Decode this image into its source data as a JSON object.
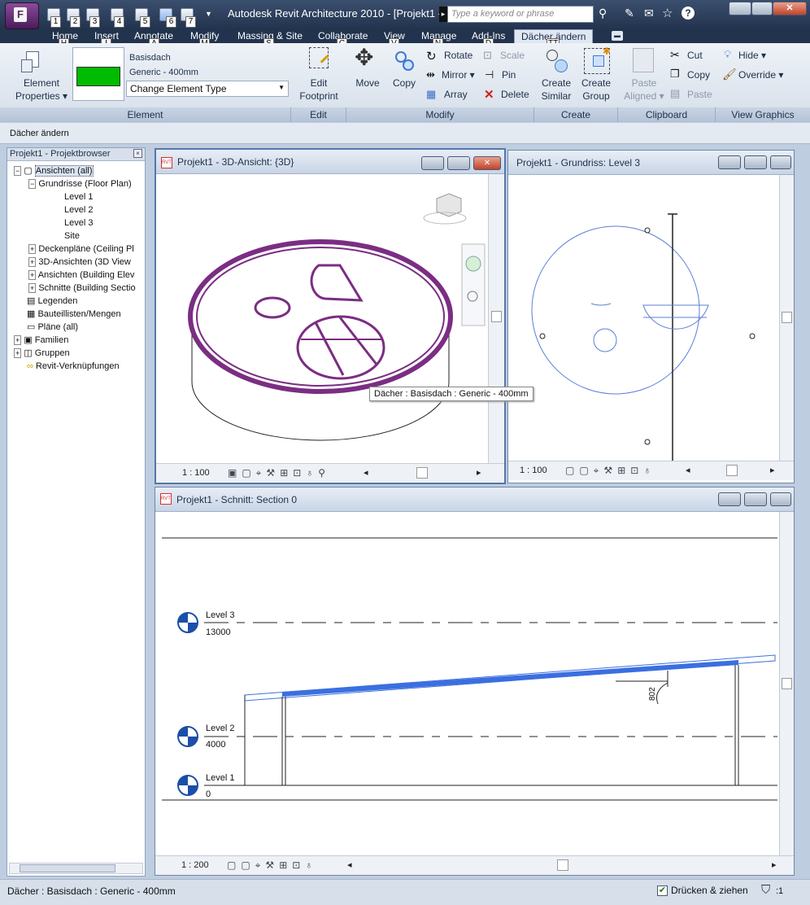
{
  "app": {
    "menu_letter": "F",
    "window_title": "Autodesk Revit Architecture 2010 - [Projekt1 - 3...",
    "search_placeholder": "Type a keyword or phrase",
    "qat_keytips": [
      "1",
      "2",
      "3",
      "4",
      "5",
      "6",
      "7"
    ],
    "help_symbol": "?"
  },
  "tabs": [
    {
      "label": "Home",
      "keytip": "H"
    },
    {
      "label": "Insert",
      "keytip": "I"
    },
    {
      "label": "Annotate",
      "keytip": "A"
    },
    {
      "label": "Modify",
      "keytip": "M"
    },
    {
      "label": "Massing & Site",
      "keytip": "S"
    },
    {
      "label": "Collaborate",
      "keytip": "C"
    },
    {
      "label": "View",
      "keytip": "V"
    },
    {
      "label": "Manage",
      "keytip": "N"
    },
    {
      "label": "Add-Ins",
      "keytip": "D"
    },
    {
      "label": "Dächer ändern",
      "keytip": ""
    }
  ],
  "tab_extra_keytip": "TT",
  "ribbon": {
    "element": {
      "properties_line1": "Element",
      "properties_line2": "Properties",
      "family": "Basisdach",
      "type": "Generic - 400mm",
      "change_type": "Change Element Type",
      "swatch_color": "#00bb00",
      "panel": "Element"
    },
    "edit": {
      "line1": "Edit",
      "line2": "Footprint",
      "panel": "Edit"
    },
    "modify": {
      "move": "Move",
      "copy": "Copy",
      "rotate": "Rotate",
      "mirror": "Mirror",
      "array": "Array",
      "scale": "Scale",
      "pin": "Pin",
      "delete": "Delete",
      "panel": "Modify"
    },
    "create": {
      "similar1": "Create",
      "similar2": "Similar",
      "group1": "Create",
      "group2": "Group",
      "panel": "Create"
    },
    "clipboard": {
      "paste1": "Paste",
      "paste2": "Aligned",
      "cut": "Cut",
      "copy": "Copy",
      "paste": "Paste",
      "panel": "Clipboard"
    },
    "view_graphics": {
      "hide": "Hide",
      "override": "Override",
      "panel": "View Graphics"
    }
  },
  "context_label": "Dächer ändern",
  "browser": {
    "title": "Projekt1 - Projektbrowser",
    "items": [
      {
        "label": "Ansichten (all)",
        "toggle": "−",
        "icon": "views-icon"
      },
      {
        "label": "Grundrisse (Floor Plan)",
        "toggle": "−"
      },
      {
        "label": "Level 1"
      },
      {
        "label": "Level 2"
      },
      {
        "label": "Level 3"
      },
      {
        "label": "Site"
      },
      {
        "label": "Deckenpläne (Ceiling Pl",
        "toggle": "+"
      },
      {
        "label": "3D-Ansichten (3D View",
        "toggle": "+"
      },
      {
        "label": "Ansichten (Building Elev",
        "toggle": "+"
      },
      {
        "label": "Schnitte (Building Sectio",
        "toggle": "+"
      },
      {
        "label": "Legenden",
        "icon": "legend-icon"
      },
      {
        "label": "Bauteillisten/Mengen",
        "icon": "schedule-icon"
      },
      {
        "label": "Pläne (all)",
        "icon": "sheet-icon"
      },
      {
        "label": "Familien",
        "toggle": "+",
        "icon": "family-icon"
      },
      {
        "label": "Gruppen",
        "toggle": "+",
        "icon": "group-icon"
      },
      {
        "label": "Revit-Verknüpfungen",
        "icon": "link-icon"
      }
    ]
  },
  "views": {
    "v3d": {
      "title": "Projekt1 - 3D-Ansicht: {3D}",
      "scale": "1 : 100",
      "roof_color": "#7b2d83"
    },
    "plan": {
      "title": "Projekt1 - Grundriss: Level 3",
      "scale": "1 : 100"
    },
    "section": {
      "title": "Projekt1 - Schnitt: Section 0",
      "scale": "1 : 200",
      "roof_color": "#3b6fe0"
    }
  },
  "levels": [
    {
      "name": "Level 3",
      "elevation": "13000"
    },
    {
      "name": "Level 2",
      "elevation": "4000"
    },
    {
      "name": "Level 1",
      "elevation": "0"
    }
  ],
  "dimension": "802",
  "tooltip": "Dächer : Basisdach : Generic - 400mm",
  "status": {
    "left": "Dächer : Basisdach : Generic - 400mm",
    "checkbox_label": "Drücken & ziehen",
    "checkbox_checked": true,
    "filter_count": ":1"
  }
}
